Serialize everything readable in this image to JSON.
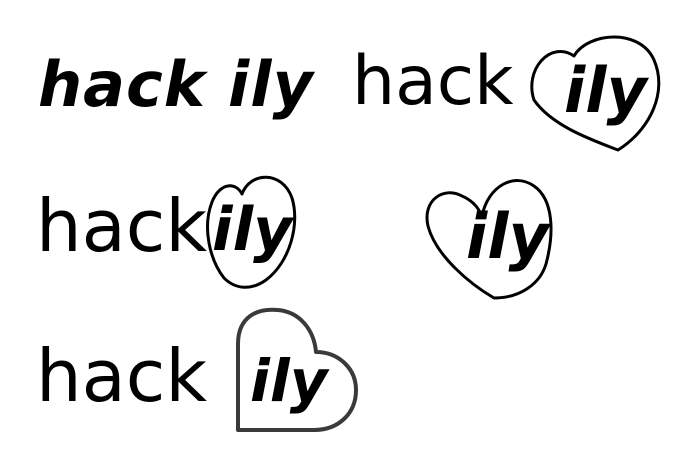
{
  "logos": [
    {
      "id": "variant-1",
      "hack": "hack",
      "ily": "ily"
    },
    {
      "id": "variant-2",
      "hack": "hack",
      "ily": "ily"
    },
    {
      "id": "variant-3",
      "hack": "hack",
      "ily": "ily"
    },
    {
      "id": "variant-4",
      "ily": "ily"
    },
    {
      "id": "variant-5",
      "hack": "hack",
      "ily": "ily"
    }
  ],
  "colors": {
    "ink": "#000000",
    "heart_outline_dark": "#000000",
    "heart_outline_gray": "#3a3a3a"
  },
  "icons": [
    "heart-outline-icon"
  ]
}
